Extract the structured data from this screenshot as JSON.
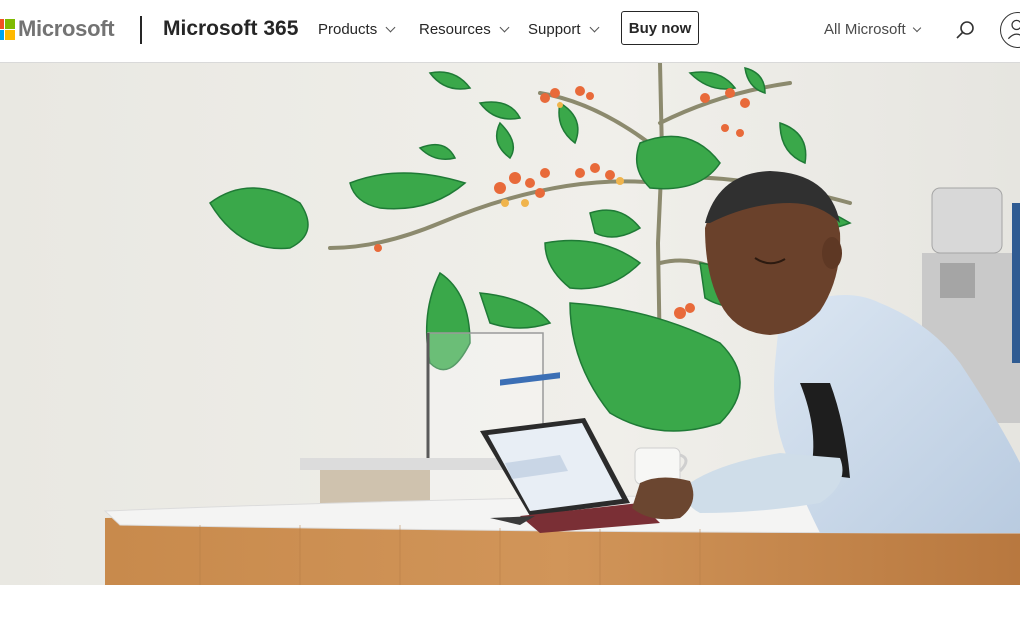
{
  "nav": {
    "brand": "Microsoft",
    "product": "Microsoft 365",
    "menu": [
      "Products",
      "Resources",
      "Support"
    ],
    "buy_now": "Buy now",
    "all_microsoft": "All Microsoft"
  },
  "colors": {
    "logo_red": "#f25022",
    "logo_green": "#7fba00",
    "logo_blue": "#00a4ef",
    "logo_yellow": "#ffb900",
    "wall": "#eceae4",
    "counter": "#f2f2f2",
    "wood": "#c98a4f"
  },
  "icons": [
    "microsoft-logo-icon",
    "chevron-down-icon",
    "search-icon",
    "account-icon"
  ],
  "hero": {
    "image": "person-using-laptop-at-counter"
  }
}
